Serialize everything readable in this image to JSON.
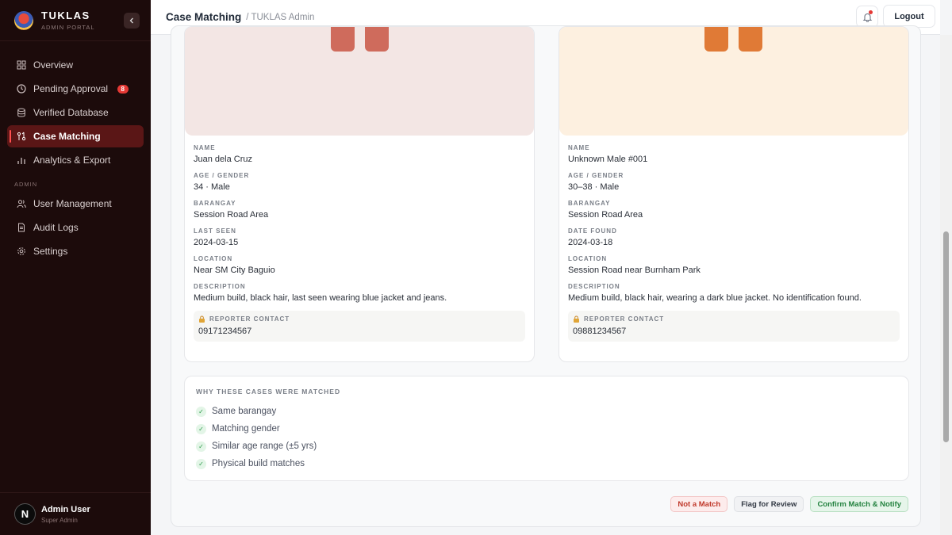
{
  "brand": {
    "name": "TUKLAS",
    "subtitle": "ADMIN PORTAL"
  },
  "sidebar": {
    "items": [
      {
        "label": "Overview",
        "icon": "grid-icon"
      },
      {
        "label": "Pending Approval",
        "icon": "clock-icon",
        "badge": "8"
      },
      {
        "label": "Verified Database",
        "icon": "database-icon"
      },
      {
        "label": "Case Matching",
        "icon": "match-icon",
        "active": true
      },
      {
        "label": "Analytics & Export",
        "icon": "bar-chart-icon"
      }
    ],
    "admin_section": "ADMIN",
    "admin_items": [
      {
        "label": "User Management",
        "icon": "users-icon"
      },
      {
        "label": "Audit Logs",
        "icon": "file-icon"
      },
      {
        "label": "Settings",
        "icon": "gear-icon"
      }
    ],
    "user": {
      "initial": "N",
      "name": "Admin User",
      "role": "Super Admin"
    }
  },
  "header": {
    "title": "Case Matching",
    "breadcrumb": "/ TUKLAS Admin",
    "logout_label": "Logout"
  },
  "missing_case": {
    "photo_color": "#f3e6e4",
    "accent_color": "#cf6b5c",
    "fields": [
      {
        "label": "NAME",
        "value": "Juan dela Cruz"
      },
      {
        "label": "AGE / GENDER",
        "value": "34 · Male"
      },
      {
        "label": "BARANGAY",
        "value": "Session Road Area"
      },
      {
        "label": "LAST SEEN",
        "value": "2024-03-15"
      },
      {
        "label": "LOCATION",
        "value": "Near SM City Baguio"
      },
      {
        "label": "DESCRIPTION",
        "value": "Medium build, black hair, last seen wearing blue jacket and jeans."
      }
    ],
    "contact_label": "REPORTER CONTACT",
    "contact_value": "09171234567"
  },
  "found_case": {
    "photo_color": "#fdf0e0",
    "accent_color": "#e07a36",
    "fields": [
      {
        "label": "NAME",
        "value": "Unknown Male #001"
      },
      {
        "label": "AGE / GENDER",
        "value": "30–38 · Male"
      },
      {
        "label": "BARANGAY",
        "value": "Session Road Area"
      },
      {
        "label": "DATE FOUND",
        "value": "2024-03-18"
      },
      {
        "label": "LOCATION",
        "value": "Session Road near Burnham Park"
      },
      {
        "label": "DESCRIPTION",
        "value": "Medium build, black hair, wearing a dark blue jacket. No identification found."
      }
    ],
    "contact_label": "REPORTER CONTACT",
    "contact_value": "09881234567"
  },
  "match_reasons": {
    "title": "WHY THESE CASES WERE MATCHED",
    "check_symbol": "✓",
    "items": [
      "Same barangay",
      "Matching gender",
      "Similar age range (±5 yrs)",
      "Physical build matches"
    ]
  },
  "actions": {
    "not_match": "Not a Match",
    "flag": "Flag for Review",
    "confirm": "Confirm Match & Notify"
  }
}
